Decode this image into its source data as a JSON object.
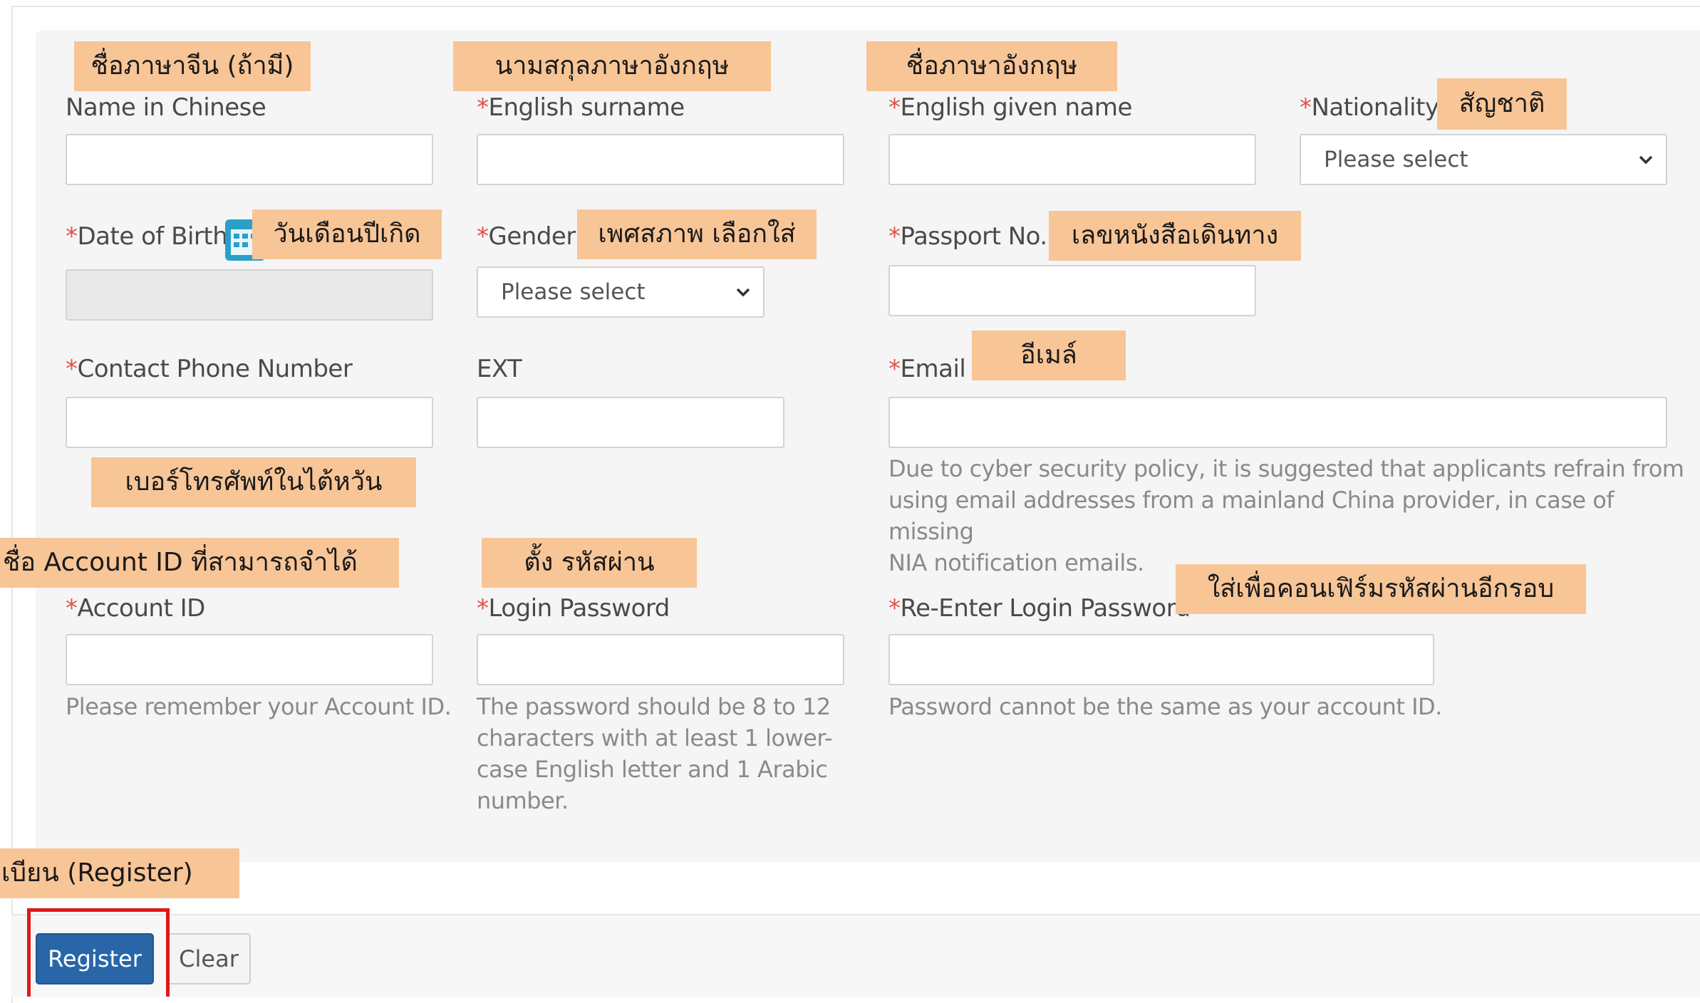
{
  "form": {
    "name_in_chinese": {
      "label": "Name in Chinese",
      "value": ""
    },
    "english_surname": {
      "required_mark": "*",
      "label": "English surname",
      "value": ""
    },
    "english_given_name": {
      "required_mark": "*",
      "label": "English given name",
      "value": ""
    },
    "nationality": {
      "required_mark": "*",
      "label": "Nationality",
      "selected": "Please select"
    },
    "date_of_birth": {
      "required_mark": "*",
      "label": "Date of Birth",
      "value": ""
    },
    "gender": {
      "required_mark": "*",
      "label": "Gender",
      "selected": "Please select"
    },
    "passport_no": {
      "required_mark": "*",
      "label": "Passport No.",
      "value": ""
    },
    "contact_phone": {
      "required_mark": "*",
      "label": "Contact Phone Number",
      "value": ""
    },
    "ext": {
      "label": "EXT",
      "value": ""
    },
    "email": {
      "required_mark": "*",
      "label": "Email",
      "value": "",
      "hint_lines": [
        "Due to cyber security policy, it is suggested that applicants refrain from",
        "using email addresses from a mainland China provider, in case of missing",
        "NIA notification emails."
      ]
    },
    "account_id": {
      "required_mark": "*",
      "label": "Account ID",
      "value": "",
      "hint": "Please remember your Account ID."
    },
    "login_password": {
      "required_mark": "*",
      "label": "Login Password",
      "value": "",
      "hint_lines": [
        "The password should be 8 to 12",
        "characters with at least 1 lower-",
        "case English letter and 1 Arabic",
        "number."
      ]
    },
    "reenter_password": {
      "required_mark": "*",
      "label": "Re-Enter Login Password",
      "value": "",
      "hint": "Password cannot be the same as your account ID."
    }
  },
  "buttons": {
    "register": "Register",
    "clear": "Clear"
  },
  "annotations": {
    "name_in_chinese": "ชื่อภาษาจีน (ถ้ามี)",
    "english_surname": "นามสกุลภาษาอังกฤษ",
    "english_given_name": "ชื่อภาษาอังกฤษ",
    "nationality": "สัญชาติ",
    "date_of_birth": "วันเดือนปีเกิด",
    "gender": "เพศสภาพ เลือกใส่",
    "passport_no": "เลขหนังสือเดินทาง",
    "email": "อีเมล์",
    "phone": "เบอร์โทรศัพท์ในไต้หวัน",
    "account_id": "ชื่อ Account ID ที่สามารถจำได้",
    "login_password": "ตั้ง รหัสผ่าน",
    "reenter_password": "ใส่เพื่อคอนเฟิร์มรหัสผ่านอีกรอบ",
    "register": "เบียน (Register)"
  },
  "colors": {
    "annotation_bg": "#f8c597",
    "register_btn": "#2866a8",
    "required": "#e0524c",
    "highlight": "#e01818"
  }
}
